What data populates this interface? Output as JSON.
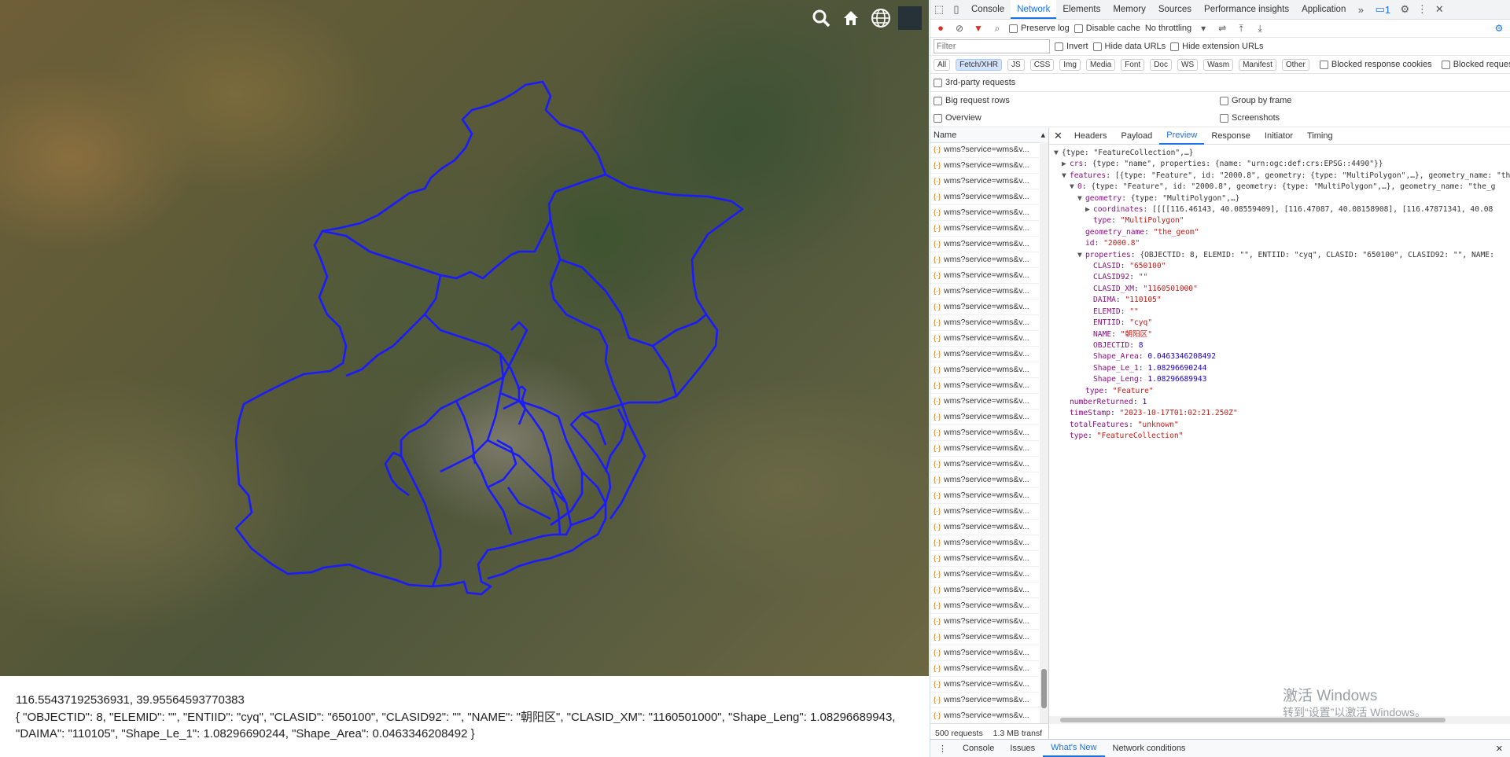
{
  "map": {
    "tools": [
      {
        "icon": "search-icon",
        "glyph": "🔍"
      },
      {
        "icon": "home-icon",
        "glyph": "⌂"
      },
      {
        "icon": "globe-icon",
        "glyph": "🌐"
      }
    ],
    "coordinates": "116.55437192536931, 39.95564593770383",
    "properties_text": "{ \"OBJECTID\": 8, \"ELEMID\": \"\", \"ENTIID\": \"cyq\", \"CLASID\": \"650100\", \"CLASID92\": \"\", \"NAME\": \"朝阳区\", \"CLASID_XM\": \"1160501000\", \"Shape_Leng\": 1.08296689943, \"DAIMA\": \"110105\", \"Shape_Le_1\": 1.08296690244, \"Shape_Area\": 0.0463346208492 }"
  },
  "devtools": {
    "tabs": [
      "Console",
      "Network",
      "Elements",
      "Memory",
      "Sources",
      "Performance insights",
      "Application"
    ],
    "active_tab": "Network",
    "message_badge": "1",
    "toolbar": {
      "preserve_log": "Preserve log",
      "disable_cache": "Disable cache",
      "throttling": "No throttling"
    },
    "filter": {
      "placeholder": "Filter",
      "invert": "Invert",
      "hide_data_urls": "Hide data URLs",
      "hide_ext_urls": "Hide extension URLs"
    },
    "type_buttons": [
      "All",
      "Fetch/XHR",
      "JS",
      "CSS",
      "Img",
      "Media",
      "Font",
      "Doc",
      "WS",
      "Wasm",
      "Manifest",
      "Other"
    ],
    "active_type": "Fetch/XHR",
    "blocked_response_cookies": "Blocked response cookies",
    "blocked_requests": "Blocked requests",
    "third_party": "3rd-party requests",
    "big_request_rows": "Big request rows",
    "group_by_frame": "Group by frame",
    "overview": "Overview",
    "screenshots": "Screenshots",
    "name_header": "Name",
    "request_name": "wms?service=wms&v...",
    "request_count_rows": 39,
    "status": {
      "requests": "500 requests",
      "transferred": "1.3 MB transf"
    },
    "preview_tabs": [
      "Headers",
      "Payload",
      "Preview",
      "Response",
      "Initiator",
      "Timing"
    ],
    "active_preview_tab": "Preview",
    "json_lines": [
      {
        "indent": 0,
        "tri": "▼",
        "key": "",
        "val": "{type: \"FeatureCollection\",…}"
      },
      {
        "indent": 1,
        "tri": "▶",
        "key": "crs",
        "val": "{type: \"name\", properties: {name: \"urn:ogc:def:crs:EPSG::4490\"}}"
      },
      {
        "indent": 1,
        "tri": "▼",
        "key": "features",
        "val": "[{type: \"Feature\", id: \"2000.8\", geometry: {type: \"MultiPolygon\",…}, geometry_name: \"the_geom\""
      },
      {
        "indent": 2,
        "tri": "▼",
        "key": "0",
        "val": "{type: \"Feature\", id: \"2000.8\", geometry: {type: \"MultiPolygon\",…}, geometry_name: \"the_g"
      },
      {
        "indent": 3,
        "tri": "▼",
        "key": "geometry",
        "val": "{type: \"MultiPolygon\",…}"
      },
      {
        "indent": 4,
        "tri": "▶",
        "key": "coordinates",
        "val": "[[[[116.46143, 40.08559409], [116.47087, 40.08158908], [116.47871341, 40.08"
      },
      {
        "indent": 4,
        "tri": "",
        "key": "type",
        "val": "\"MultiPolygon\""
      },
      {
        "indent": 3,
        "tri": "",
        "key": "geometry_name",
        "val": "\"the_geom\""
      },
      {
        "indent": 3,
        "tri": "",
        "key": "id",
        "val": "\"2000.8\""
      },
      {
        "indent": 3,
        "tri": "▼",
        "key": "properties",
        "val": "{OBJECTID: 8, ELEMID: \"\", ENTIID: \"cyq\", CLASID: \"650100\", CLASID92: \"\", NAME:"
      },
      {
        "indent": 4,
        "tri": "",
        "key": "CLASID",
        "val": "\"650100\""
      },
      {
        "indent": 4,
        "tri": "",
        "key": "CLASID92",
        "val": "\"\""
      },
      {
        "indent": 4,
        "tri": "",
        "key": "CLASID_XM",
        "val": "\"1160501000\""
      },
      {
        "indent": 4,
        "tri": "",
        "key": "DAIMA",
        "val": "\"110105\""
      },
      {
        "indent": 4,
        "tri": "",
        "key": "ELEMID",
        "val": "\"\""
      },
      {
        "indent": 4,
        "tri": "",
        "key": "ENTIID",
        "val": "\"cyq\""
      },
      {
        "indent": 4,
        "tri": "",
        "key": "NAME",
        "val": "\"朝阳区\""
      },
      {
        "indent": 4,
        "tri": "",
        "key": "OBJECTID",
        "val": "8"
      },
      {
        "indent": 4,
        "tri": "",
        "key": "Shape_Area",
        "val": "0.0463346208492"
      },
      {
        "indent": 4,
        "tri": "",
        "key": "Shape_Le_1",
        "val": "1.08296690244"
      },
      {
        "indent": 4,
        "tri": "",
        "key": "Shape_Leng",
        "val": "1.08296689943"
      },
      {
        "indent": 3,
        "tri": "",
        "key": "type",
        "val": "\"Feature\""
      },
      {
        "indent": 1,
        "tri": "",
        "key": "numberReturned",
        "val": "1"
      },
      {
        "indent": 1,
        "tri": "",
        "key": "timeStamp",
        "val": "\"2023-10-17T01:02:21.250Z\""
      },
      {
        "indent": 1,
        "tri": "",
        "key": "totalFeatures",
        "val": "\"unknown\""
      },
      {
        "indent": 1,
        "tri": "",
        "key": "type",
        "val": "\"FeatureCollection\""
      }
    ],
    "watermark_title": "激活 Windows",
    "watermark_sub": "转到“设置”以激活 Windows。",
    "drawer_tabs": [
      "Console",
      "Issues",
      "What's New",
      "Network conditions"
    ],
    "active_drawer_tab": "What's New"
  },
  "colors": {
    "boundary": "#1a1aff",
    "accent": "#1a73e8"
  }
}
